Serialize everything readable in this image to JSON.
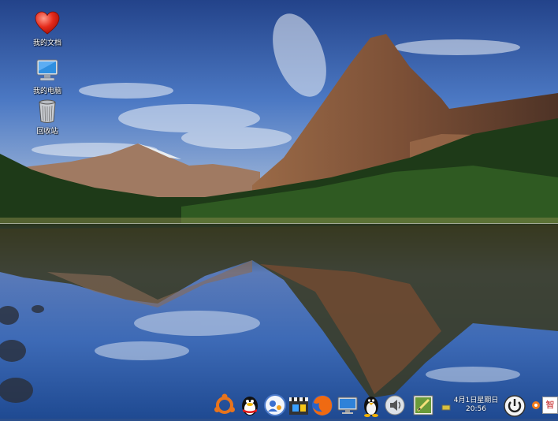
{
  "desktop": {
    "icons": [
      {
        "label": "我的文档",
        "icon": "heart-icon"
      },
      {
        "label": "我的电脑",
        "icon": "computer-icon"
      },
      {
        "label": "回收站",
        "icon": "trash-icon"
      }
    ]
  },
  "taskbar": {
    "apps": [
      {
        "name": "ubuntu-icon"
      },
      {
        "name": "qq-penguin-icon"
      },
      {
        "name": "video-chat-icon"
      },
      {
        "name": "clapperboard-icon"
      },
      {
        "name": "firefox-icon"
      },
      {
        "name": "monitor-icon"
      },
      {
        "name": "linux-penguin-icon"
      },
      {
        "name": "speaker-icon"
      },
      {
        "name": "notepad-icon"
      }
    ],
    "clock": {
      "date": "4月1日星期日",
      "time": "20:56"
    },
    "tray": {
      "power": "power-icon",
      "input_method": "智"
    }
  },
  "colors": {
    "sky": "#3a67b8",
    "mountain": "#8a5a3c",
    "forest": "#1f3d1a",
    "water": "#2e62b0"
  }
}
